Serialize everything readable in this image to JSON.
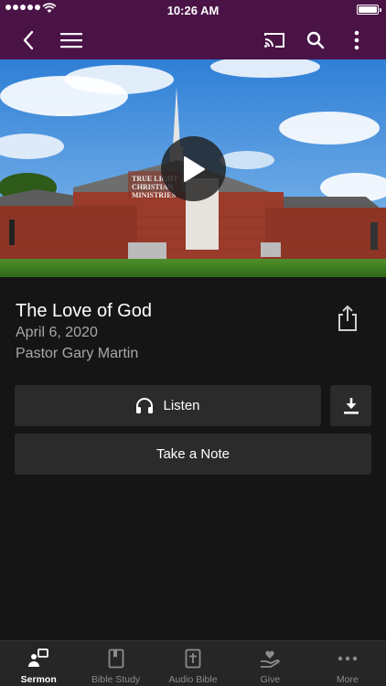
{
  "status_bar": {
    "time": "10:26 AM"
  },
  "nav": {
    "icons": [
      "back-icon",
      "menu-icon",
      "cast-icon",
      "search-icon",
      "more-vertical-icon"
    ]
  },
  "hero": {
    "sign_lines": [
      "TRUE LIGHT",
      "CHRISTIAN",
      "MINISTRIES"
    ]
  },
  "sermon": {
    "title": "The Love of God",
    "date": "April 6, 2020",
    "speaker": "Pastor Gary Martin"
  },
  "actions": {
    "listen_label": "Listen",
    "note_label": "Take a Note"
  },
  "tabbar": {
    "items": [
      {
        "label": "Sermon",
        "icon": "sermon-icon",
        "active": true
      },
      {
        "label": "Bible Study",
        "icon": "book-icon",
        "active": false
      },
      {
        "label": "Audio Bible",
        "icon": "bible-cross-icon",
        "active": false
      },
      {
        "label": "Give",
        "icon": "hand-heart-icon",
        "active": false
      },
      {
        "label": "More",
        "icon": "more-horizontal-icon",
        "active": false
      }
    ]
  },
  "colors": {
    "nav_bg": "#4a1346",
    "page_bg": "#151515",
    "button_bg": "#2b2b2b",
    "tabbar_bg": "#262626"
  }
}
